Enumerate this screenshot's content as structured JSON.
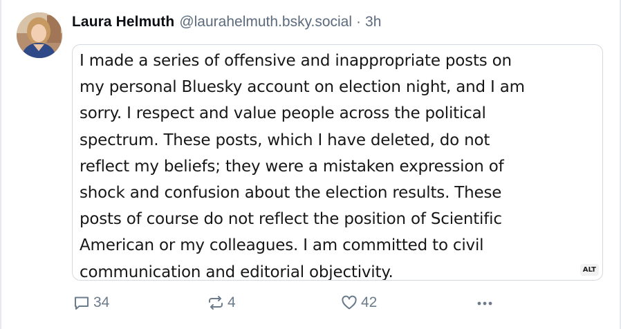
{
  "post": {
    "author_name": "Laura Helmuth",
    "handle": "@laurahelmuth.bsky.social",
    "separator": "·",
    "time": "3h",
    "image_text_lines": [
      "I made a series of offensive and inappropriate posts on",
      "my personal Bluesky account on election night, and I am",
      "sorry. I respect and value people across the political",
      "spectrum. These posts, which I have deleted, do not",
      "reflect my beliefs; they were a mistaken expression of",
      "shock and confusion about the election results. These",
      "posts of course do not reflect the position of Scientific",
      "American or my colleagues. I am committed to civil",
      "communication and editorial objectivity."
    ],
    "alt_badge": "ALT"
  },
  "actions": {
    "reply_count": "34",
    "repost_count": "4",
    "like_count": "42"
  },
  "icons": {
    "reply": "speech-bubble-icon",
    "repost": "repost-arrows-icon",
    "like": "heart-icon",
    "more": "ellipsis-icon"
  },
  "colors": {
    "muted_text": "#6b7b8c",
    "border": "#d4d9df"
  }
}
